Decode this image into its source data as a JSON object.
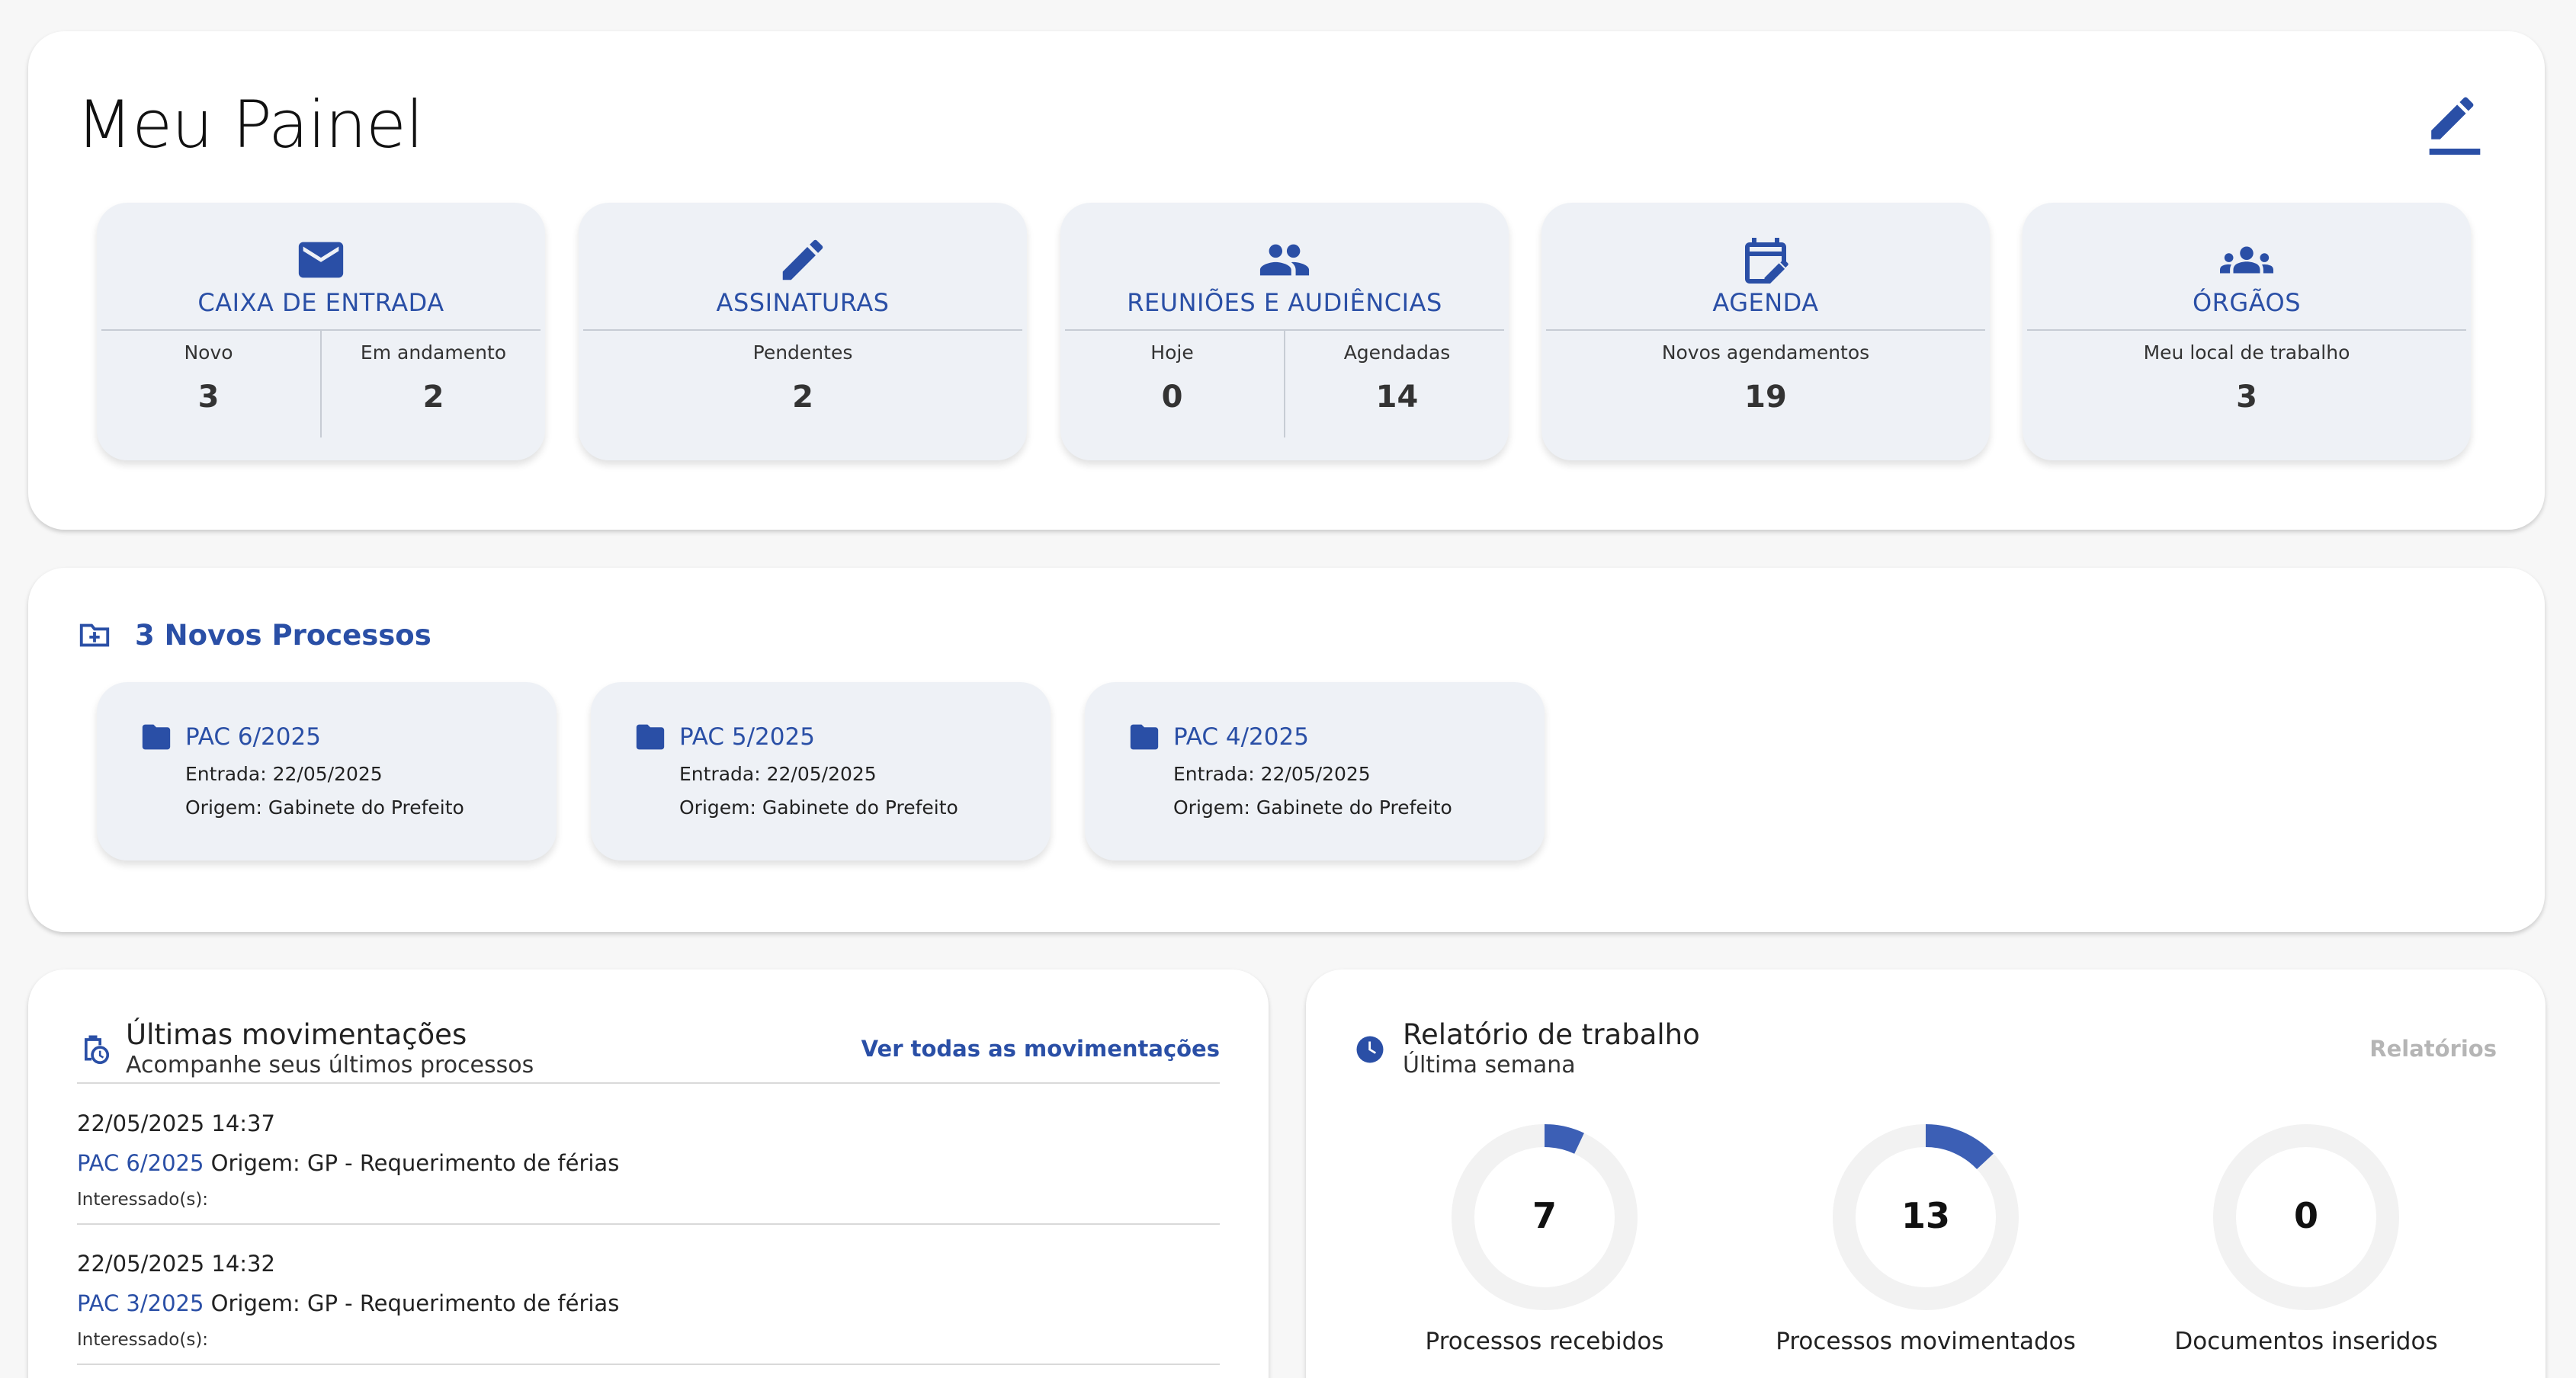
{
  "painel": {
    "title": "Meu Painel",
    "cards": [
      {
        "title": "CAIXA DE ENTRADA",
        "icon": "mail-icon",
        "stats": [
          {
            "label": "Novo",
            "value": "3"
          },
          {
            "label": "Em andamento",
            "value": "2"
          }
        ]
      },
      {
        "title": "ASSINATURAS",
        "icon": "pencil-icon",
        "stats": [
          {
            "label": "Pendentes",
            "value": "2"
          }
        ]
      },
      {
        "title": "REUNIÕES E AUDIÊNCIAS",
        "icon": "people-icon",
        "stats": [
          {
            "label": "Hoje",
            "value": "0"
          },
          {
            "label": "Agendadas",
            "value": "14"
          }
        ]
      },
      {
        "title": "AGENDA",
        "icon": "calendar-edit-icon",
        "stats": [
          {
            "label": "Novos agendamentos",
            "value": "19"
          }
        ]
      },
      {
        "title": "ÓRGÃOS",
        "icon": "groups-icon",
        "stats": [
          {
            "label": "Meu local de trabalho",
            "value": "3"
          }
        ]
      }
    ]
  },
  "novos": {
    "title": "3 Novos Processos",
    "items": [
      {
        "name": "PAC 6/2025",
        "entrada": "Entrada: 22/05/2025",
        "origem": "Origem: Gabinete do Prefeito"
      },
      {
        "name": "PAC 5/2025",
        "entrada": "Entrada: 22/05/2025",
        "origem": "Origem: Gabinete do Prefeito"
      },
      {
        "name": "PAC 4/2025",
        "entrada": "Entrada: 22/05/2025",
        "origem": "Origem: Gabinete do Prefeito"
      }
    ]
  },
  "movs": {
    "title": "Últimas movimentações",
    "subtitle": "Acompanhe seus últimos processos",
    "link": "Ver todas as movimentações",
    "items": [
      {
        "date": "22/05/2025 14:37",
        "pac": "PAC 6/2025",
        "desc": " Origem: GP - Requerimento de férias",
        "interessado": "Interessado(s):"
      },
      {
        "date": "22/05/2025 14:32",
        "pac": "PAC 3/2025",
        "desc": " Origem: GP - Requerimento de férias",
        "interessado": "Interessado(s):"
      }
    ]
  },
  "rel": {
    "title": "Relatório de trabalho",
    "subtitle": "Última semana",
    "link": "Relatórios",
    "stats": [
      {
        "value": "7",
        "label": "Processos recebidos",
        "fraction": 0.07
      },
      {
        "value": "13",
        "label": "Processos movimentados",
        "fraction": 0.13
      },
      {
        "value": "0",
        "label": "Documentos inseridos",
        "fraction": 0
      }
    ]
  },
  "colors": {
    "accent": "#2a4fa6",
    "card_bg": "#eef1f6",
    "donut_track": "#f2f2f2",
    "donut_fill": "#3c5fb5"
  }
}
